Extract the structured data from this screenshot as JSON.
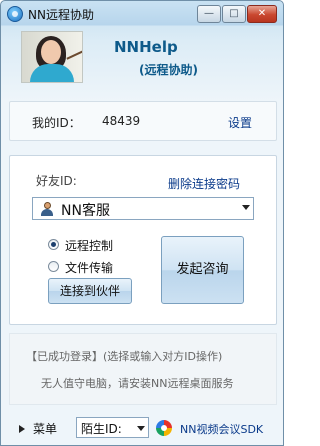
{
  "window": {
    "title": "NN远程协助",
    "minimize_glyph": "—",
    "maximize_glyph": "□",
    "close_glyph": "✕"
  },
  "header": {
    "brand": "NNHelp",
    "subtitle": "(远程协助)"
  },
  "id_panel": {
    "label": "我的ID：",
    "value": "48439",
    "settings_label": "设置"
  },
  "main": {
    "friend_id_label": "好友ID:",
    "delete_password_label": "删除连接密码",
    "friend_combo_value": "NN客服",
    "radio_options": [
      {
        "label": "远程控制",
        "checked": true
      },
      {
        "label": "文件传输",
        "checked": false
      }
    ],
    "connect_button": "连接到伙伴",
    "consult_button": "发起咨询"
  },
  "status": {
    "line1": "【已成功登录】(选择或输入对方ID操作)",
    "line2": "无人值守电脑，请安装NN远程桌面服务"
  },
  "bottom": {
    "menu_label": "菜单",
    "stranger_id_label": "陌生ID:",
    "sdk_link": "NN视频会议SDK"
  },
  "colors": {
    "link": "#0a3a8a",
    "brand": "#0e5a8a",
    "close_button": "#c9472f"
  },
  "icons": {
    "app": "nn-logo-icon",
    "user": "user-icon",
    "sdk": "sdk-logo-icon"
  }
}
